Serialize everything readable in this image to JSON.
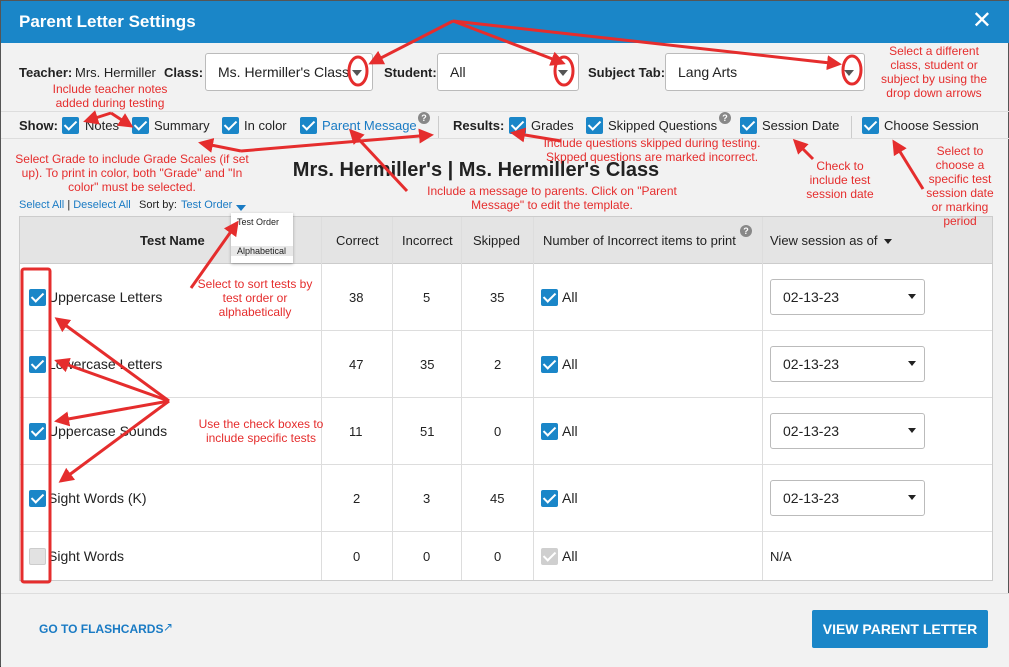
{
  "header": {
    "title": "Parent Letter Settings",
    "close_icon": "close-icon"
  },
  "filters": {
    "teacher_label": "Teacher:",
    "teacher_value": "Mrs. Hermiller",
    "class_label": "Class:",
    "class_value": "Ms. Hermiller's Class",
    "student_label": "Student:",
    "student_value": "All",
    "subject_label": "Subject Tab:",
    "subject_value": "Lang Arts"
  },
  "show": {
    "label": "Show:",
    "options": [
      {
        "label": "Notes",
        "checked": true
      },
      {
        "label": "Summary",
        "checked": true
      },
      {
        "label": "In color",
        "checked": true
      },
      {
        "label": "Parent Message",
        "checked": true
      }
    ]
  },
  "results": {
    "label": "Results:",
    "options": [
      {
        "label": "Grades",
        "checked": true
      },
      {
        "label": "Skipped Questions",
        "checked": true
      },
      {
        "label": "Session Date",
        "checked": true
      },
      {
        "label": "Choose Session",
        "checked": true
      }
    ]
  },
  "heading": "Mrs. Hermiller's | Ms. Hermiller's Class",
  "select_all": "Select All",
  "deselect_all": "Deselect All",
  "sort_label": "Sort by:",
  "sort_value": "Test Order",
  "sort_options": [
    "Test Order",
    "Alphabetical"
  ],
  "table": {
    "columns": [
      "Test Name",
      "Correct",
      "Incorrect",
      "Skipped",
      "Number of Incorrect items to print",
      "View session as of"
    ],
    "rows": [
      {
        "name": "Uppercase Letters",
        "correct": "38",
        "incorrect": "5",
        "skipped": "35",
        "print": "All",
        "session": "02-13-23",
        "checked": true
      },
      {
        "name": "Lowercase Letters",
        "correct": "47",
        "incorrect": "35",
        "skipped": "2",
        "print": "All",
        "session": "02-13-23",
        "checked": true
      },
      {
        "name": "Uppercase Sounds",
        "correct": "11",
        "incorrect": "51",
        "skipped": "0",
        "print": "All",
        "session": "02-13-23",
        "checked": true
      },
      {
        "name": "Sight Words (K)",
        "correct": "2",
        "incorrect": "3",
        "skipped": "45",
        "print": "All",
        "session": "02-13-23",
        "checked": true
      },
      {
        "name": "Sight Words",
        "correct": "0",
        "incorrect": "0",
        "skipped": "0",
        "print": "All",
        "session": "N/A",
        "checked": false
      }
    ]
  },
  "footer": {
    "flashcards": "GO TO FLASHCARDS",
    "view_button": "VIEW PARENT LETTER"
  },
  "annotations": {
    "dropdowns": "Select a different class, student or subject by using the drop down arrows",
    "notes": "Include teacher notes added during testing",
    "grades": "Select Grade to include Grade Scales (if set up). To print in color, both \"Grade\" and \"In color\" must be selected.",
    "skipped": "Include questions skipped during testing. Skpped questions are marked incorrect.",
    "message": "Include a message to parents. Click on \"Parent Message\" to edit the template.",
    "session_date": "Check to include test session date",
    "choose_session": "Select to choose a specific test session date or marking period",
    "sort": "Select to sort tests by test order or alphabetically",
    "checkboxes": "Use the check boxes to include specific tests"
  },
  "colors": {
    "primary": "#1a86c8",
    "annotation": "#e52d2d"
  }
}
